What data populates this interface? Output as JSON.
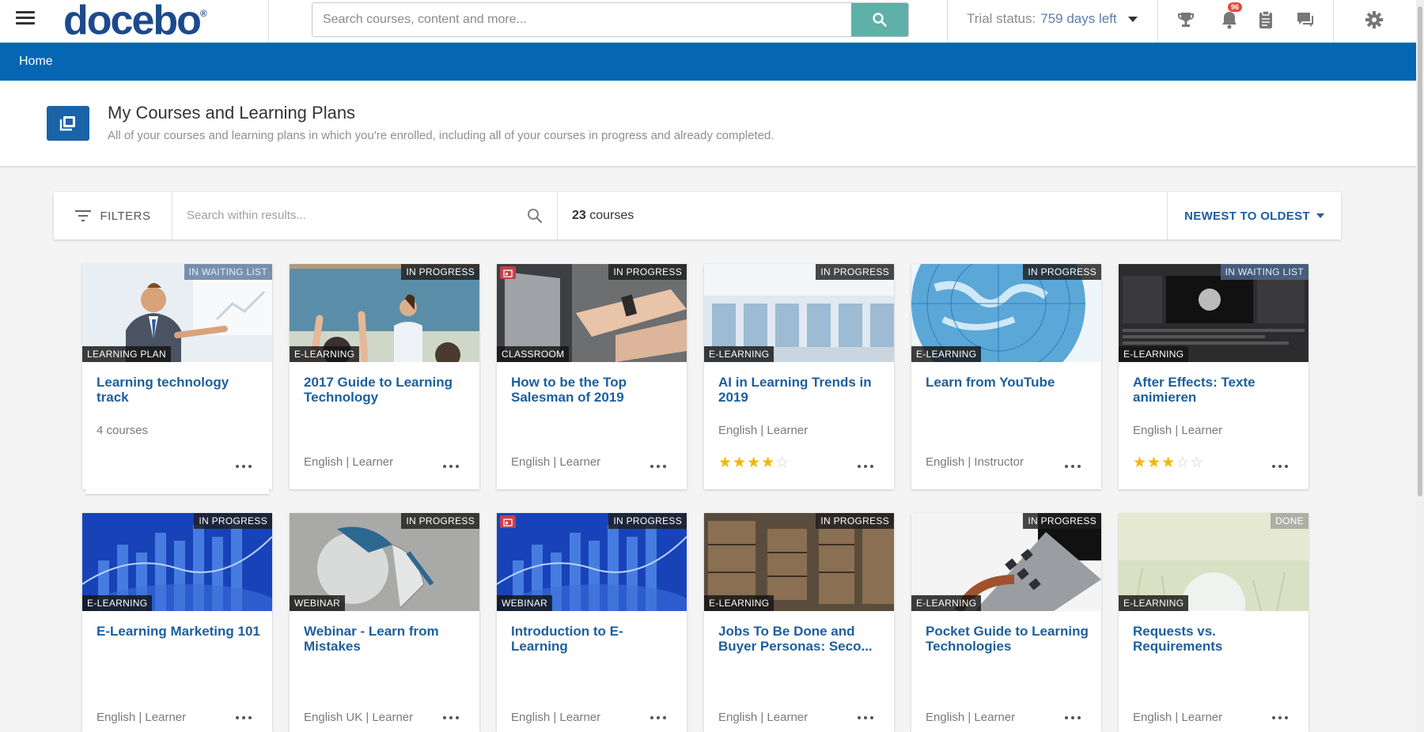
{
  "header": {
    "logo_text": "docebo",
    "logo_mark": "®",
    "search_placeholder": "Search courses, content and more...",
    "trial_label": "Trial status:",
    "trial_days": "759 days left",
    "notifications_count": "96",
    "icons": [
      "menu-icon",
      "search-icon",
      "trophy-icon",
      "bell-icon",
      "clipboard-icon",
      "chat-icon",
      "gear-icon"
    ]
  },
  "breadcrumb": {
    "home": "Home"
  },
  "page": {
    "title": "My Courses and Learning Plans",
    "subtitle": "All of your courses and learning plans in which you're enrolled, including all of your courses in progress and already completed."
  },
  "filterbar": {
    "filters_label": "FILTERS",
    "search_placeholder": "Search within results...",
    "count_number": "23",
    "count_label": "courses",
    "sort_label": "NEWEST TO OLDEST"
  },
  "cards": [
    {
      "title": "Learning technology track",
      "status": "IN WAITING LIST",
      "type": "LEARNING PLAN",
      "meta": "4 courses",
      "rating": null,
      "thumb": "presenter"
    },
    {
      "title": "2017 Guide to Learning Technology",
      "status": "IN PROGRESS",
      "type": "E-LEARNING",
      "meta": "English | Learner",
      "rating": null,
      "thumb": "classroom"
    },
    {
      "title": "How to be the Top Salesman of 2019",
      "status": "IN PROGRESS",
      "type": "CLASSROOM",
      "meta": "English | Learner",
      "rating": null,
      "thumb": "laptop"
    },
    {
      "title": "AI in Learning Trends in 2019",
      "status": "IN PROGRESS",
      "type": "E-LEARNING",
      "meta": "English | Learner",
      "rating": 4,
      "thumb": "office"
    },
    {
      "title": "Learn from YouTube",
      "status": "IN PROGRESS",
      "type": "E-LEARNING",
      "meta": "English | Instructor",
      "rating": null,
      "thumb": "globe"
    },
    {
      "title": "After Effects: Texte animieren",
      "status": "IN WAITING LIST",
      "type": "E-LEARNING",
      "meta": "English | Learner",
      "rating": 3,
      "thumb": "software"
    },
    {
      "title": "E-Learning Marketing 101",
      "status": "IN PROGRESS",
      "type": "E-LEARNING",
      "meta": "English | Learner",
      "rating": null,
      "thumb": "chart"
    },
    {
      "title": "Webinar - Learn from Mistakes",
      "status": "IN PROGRESS",
      "type": "WEBINAR",
      "meta": "English UK | Learner",
      "rating": null,
      "thumb": "figure"
    },
    {
      "title": "Introduction to E-Learning",
      "status": "IN PROGRESS",
      "type": "WEBINAR",
      "meta": "English | Learner",
      "rating": null,
      "thumb": "chart"
    },
    {
      "title": "Jobs To Be Done and Buyer Personas: Seco...",
      "status": "IN PROGRESS",
      "type": "E-LEARNING",
      "meta": "English | Learner",
      "rating": null,
      "thumb": "warehouse"
    },
    {
      "title": "Pocket Guide to Learning Technologies",
      "status": "IN PROGRESS",
      "type": "E-LEARNING",
      "meta": "English | Learner",
      "rating": null,
      "thumb": "keyboard"
    },
    {
      "title": "Requests vs. Requirements",
      "status": "DONE",
      "type": "E-LEARNING",
      "meta": "English | Learner",
      "rating": null,
      "thumb": "grass"
    }
  ],
  "colors": {
    "brand_blue": "#0566b4",
    "link_blue": "#1c5f9e",
    "search_button": "#5fb0a9",
    "star": "#f2b700"
  }
}
